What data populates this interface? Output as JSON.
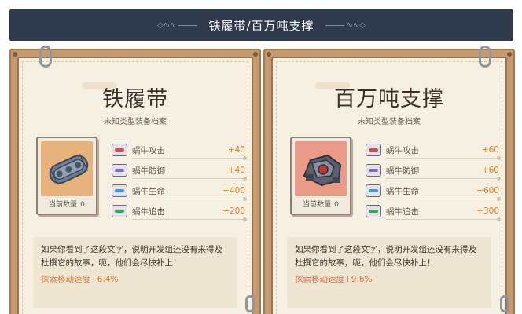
{
  "header": {
    "title": "铁履带/百万吨支撑",
    "left_ornament": "◇∿∿",
    "right_ornament": "∿∿◇"
  },
  "cards": [
    {
      "name": "铁履带",
      "subtitle": "未知类型装备档案",
      "count_label": "当前数量",
      "count_value": "0",
      "stats": [
        {
          "label": "蜗牛攻击",
          "value": "+40",
          "icon": "attack-icon"
        },
        {
          "label": "蜗牛防御",
          "value": "+40",
          "icon": "defense-icon"
        },
        {
          "label": "蜗牛生命",
          "value": "+400",
          "icon": "hp-icon"
        },
        {
          "label": "蜗牛追击",
          "value": "+200",
          "icon": "chase-icon"
        }
      ],
      "description": "如果你看到了这段文字，说明开发组还没有来得及杜撰它的故事，呃，他们会尽快补上！",
      "bonus": "探索移动速度+6.4%"
    },
    {
      "name": "百万吨支撑",
      "subtitle": "未知类型装备档案",
      "count_label": "当前数量",
      "count_value": "0",
      "stats": [
        {
          "label": "蜗牛攻击",
          "value": "+60",
          "icon": "attack-icon"
        },
        {
          "label": "蜗牛防御",
          "value": "+60",
          "icon": "defense-icon"
        },
        {
          "label": "蜗牛生命",
          "value": "+600",
          "icon": "hp-icon"
        },
        {
          "label": "蜗牛追击",
          "value": "+300",
          "icon": "chase-icon"
        }
      ],
      "description": "如果你看到了这段文字，说明开发组还没有来得及杜撰它的故事，呃，他们会尽快补上！",
      "bonus": "探索移动速度+9.6%"
    }
  ]
}
